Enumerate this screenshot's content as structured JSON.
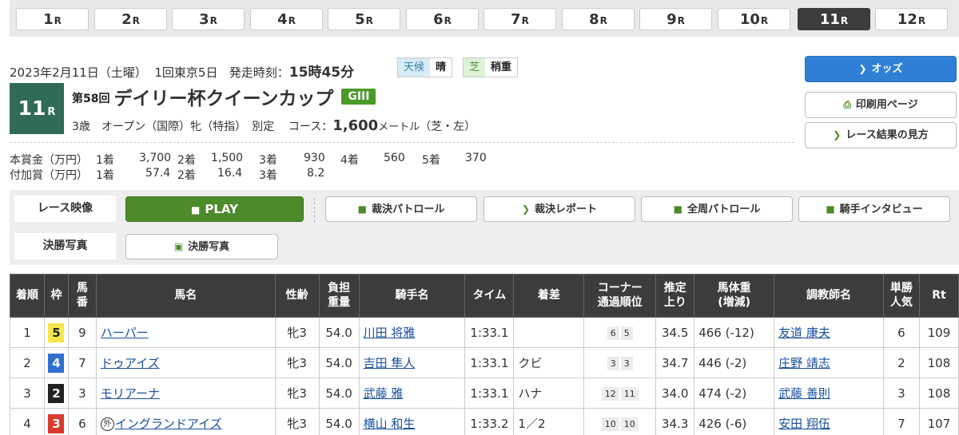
{
  "race_tabs": [
    {
      "num": "1",
      "suffix": "R"
    },
    {
      "num": "2",
      "suffix": "R"
    },
    {
      "num": "3",
      "suffix": "R"
    },
    {
      "num": "4",
      "suffix": "R"
    },
    {
      "num": "5",
      "suffix": "R"
    },
    {
      "num": "6",
      "suffix": "R"
    },
    {
      "num": "7",
      "suffix": "R"
    },
    {
      "num": "8",
      "suffix": "R"
    },
    {
      "num": "9",
      "suffix": "R"
    },
    {
      "num": "10",
      "suffix": "R"
    },
    {
      "num": "11",
      "suffix": "R"
    },
    {
      "num": "12",
      "suffix": "R"
    }
  ],
  "race_info": {
    "date": "2023年2月11日（土曜）",
    "meeting": "1回東京5日",
    "start_label": "発走時刻：",
    "start_time": "15時45分",
    "weather_label": "天候",
    "weather": "晴",
    "track_label": "芝",
    "track_condition": "稍重",
    "race_number": "11",
    "race_number_suffix": "R",
    "edition": "第58回",
    "race_name": "デイリー杯クイーンカップ",
    "grade": "GIII",
    "conditions": "3歳　オープン（国際）牝（特指）　別定",
    "course_label": "コース：",
    "distance": "1,600",
    "distance_unit": "メートル",
    "course_detail": "（芝・左）"
  },
  "side_buttons": {
    "odds": "オッズ",
    "print": "印刷用ページ",
    "guide": "レース結果の見方"
  },
  "prize": {
    "main_label": "本賞金（万円）",
    "add_label": "付加賞（万円）",
    "main": [
      {
        "place": "1着",
        "amount": "3,700"
      },
      {
        "place": "2着",
        "amount": "1,500"
      },
      {
        "place": "3着",
        "amount": "930"
      },
      {
        "place": "4着",
        "amount": "560"
      },
      {
        "place": "5着",
        "amount": "370"
      }
    ],
    "add": [
      {
        "place": "1着",
        "amount": "57.4"
      },
      {
        "place": "2着",
        "amount": "16.4"
      },
      {
        "place": "3着",
        "amount": "8.2"
      }
    ]
  },
  "media": {
    "video_label": "レース映像",
    "play": "PLAY",
    "patrol": "裁決パトロール",
    "report": "裁決レポート",
    "full_patrol": "全周パトロール",
    "interview": "騎手インタビュー",
    "photo_label": "決勝写真",
    "photo_btn": "決勝写真"
  },
  "table": {
    "headers": {
      "place": "着順",
      "waku": "枠",
      "umaban": "馬\n番",
      "horse": "馬名",
      "sex_age": "性齢",
      "weight": "負担\n重量",
      "jockey": "騎手名",
      "time": "タイム",
      "margin": "着差",
      "corner": "コーナー\n通過順位",
      "last3f": "推定\n上り",
      "body": "馬体重\n(増減)",
      "trainer": "調教師名",
      "pop": "単勝\n人気",
      "rt": "Rt"
    },
    "rows": [
      {
        "place": "1",
        "waku": "5",
        "waku_color": "#f7e64b",
        "waku_text": "#222",
        "umaban": "9",
        "foreign": "",
        "horse": "ハーパー",
        "sex_age": "牝3",
        "weight": "54.0",
        "jockey": "川田 将雅",
        "time": "1:33.1",
        "margin": "",
        "corners": [
          "6",
          "5"
        ],
        "last3f": "34.5",
        "body": "466 (-12)",
        "trainer": "友道 康夫",
        "pop": "6",
        "rt": "109"
      },
      {
        "place": "2",
        "waku": "4",
        "waku_color": "#2f6fd0",
        "waku_text": "#fff",
        "umaban": "7",
        "foreign": "",
        "horse": "ドゥアイズ",
        "sex_age": "牝3",
        "weight": "54.0",
        "jockey": "吉田 隼人",
        "time": "1:33.1",
        "margin": "クビ",
        "corners": [
          "3",
          "3"
        ],
        "last3f": "34.7",
        "body": "446 (-2)",
        "trainer": "庄野 靖志",
        "pop": "2",
        "rt": "108"
      },
      {
        "place": "3",
        "waku": "2",
        "waku_color": "#222222",
        "waku_text": "#fff",
        "umaban": "3",
        "foreign": "",
        "horse": "モリアーナ",
        "sex_age": "牝3",
        "weight": "54.0",
        "jockey": "武藤 雅",
        "time": "1:33.1",
        "margin": "ハナ",
        "corners": [
          "12",
          "11"
        ],
        "last3f": "34.0",
        "body": "474 (-2)",
        "trainer": "武藤 善則",
        "pop": "3",
        "rt": "108"
      },
      {
        "place": "4",
        "waku": "3",
        "waku_color": "#d83a2e",
        "waku_text": "#fff",
        "umaban": "6",
        "foreign": "外",
        "horse": "イングランドアイズ",
        "sex_age": "牝3",
        "weight": "54.0",
        "jockey": "横山 和生",
        "time": "1:33.2",
        "margin": "1／2",
        "corners": [
          "10",
          "10"
        ],
        "last3f": "34.3",
        "body": "426 (-6)",
        "trainer": "安田 翔伍",
        "pop": "7",
        "rt": "107"
      }
    ]
  }
}
